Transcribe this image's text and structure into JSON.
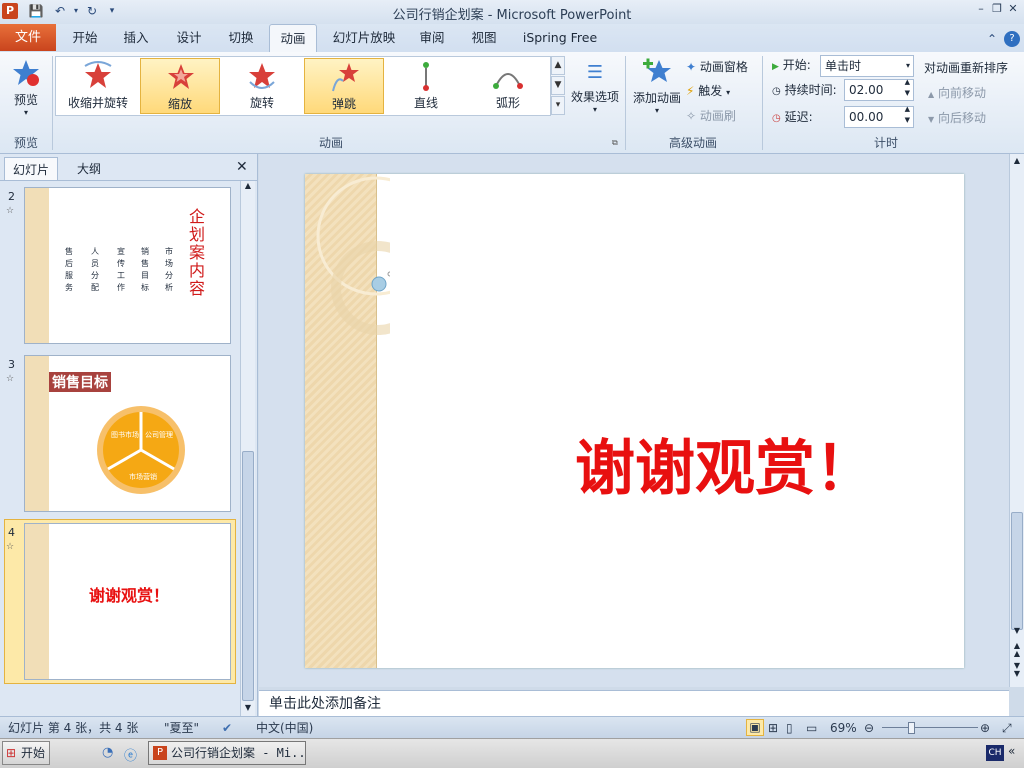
{
  "window": {
    "title": "公司行销企划案 - Microsoft PowerPoint"
  },
  "tabs": {
    "file": "文件",
    "items": [
      "开始",
      "插入",
      "设计",
      "切换",
      "动画",
      "幻灯片放映",
      "审阅",
      "视图",
      "iSpring Free"
    ]
  },
  "ribbon": {
    "preview": {
      "label": "预览",
      "group": "预览"
    },
    "gallery": [
      "收缩并旋转",
      "缩放",
      "旋转",
      "弹跳",
      "直线",
      "弧形"
    ],
    "effect_options": "效果选项",
    "animation_group": "动画",
    "add_animation": "添加动画",
    "animation_pane": "动画窗格",
    "trigger": "触发",
    "animation_painter": "动画刷",
    "advanced_group": "高级动画",
    "start_label": "开始:",
    "start_value": "单击时",
    "duration_label": "持续时间:",
    "duration_value": "02.00",
    "delay_label": "延迟:",
    "delay_value": "00.00",
    "timing_group": "计时",
    "reorder_title": "对动画重新排序",
    "move_earlier": "向前移动",
    "move_later": "向后移动"
  },
  "panel": {
    "tab_slides": "幻灯片",
    "tab_outline": "大纲",
    "close": "✕"
  },
  "thumbnails": [
    {
      "num": "2",
      "title": "企划案内容",
      "bullets": [
        "售后服务",
        "人员分配",
        "宣传工作",
        "销售目标",
        "市场分析"
      ]
    },
    {
      "num": "3",
      "title": "销售目标",
      "segments": [
        "图书市场",
        "公司管理",
        "市场营销"
      ]
    },
    {
      "num": "4",
      "text": "谢谢观赏！"
    }
  ],
  "slide": {
    "text": "谢谢观赏！"
  },
  "notes": {
    "placeholder": "单击此处添加备注"
  },
  "status": {
    "slide_info": "幻灯片 第 4 张，共 4 张",
    "theme": "\"夏至\"",
    "language": "中文(中国)",
    "zoom": "69%"
  },
  "taskbar": {
    "start": "开始",
    "item": "公司行销企划案 - Mi...",
    "ime": "CH"
  }
}
